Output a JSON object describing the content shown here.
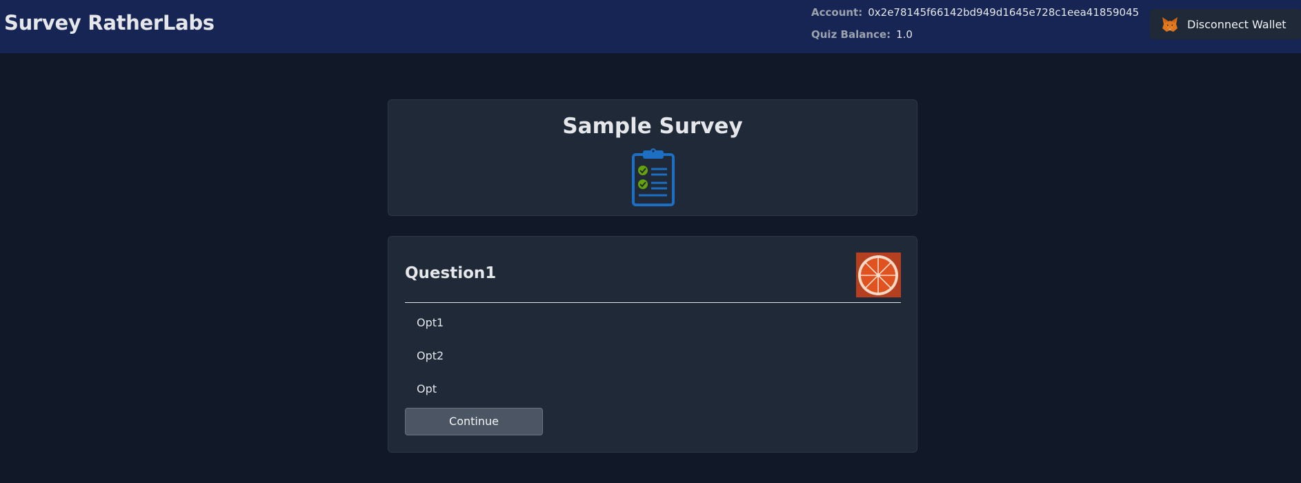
{
  "header": {
    "brand": "Survey RatherLabs",
    "account_label": "Account:",
    "account_value": "0x2e78145f66142bd949d1645e728c1eea41859045",
    "balance_label": "Quiz Balance:",
    "balance_value": "1.0",
    "wallet_button_label": "Disconnect Wallet",
    "wallet_icon": "metamask-fox-icon"
  },
  "survey": {
    "title": "Sample Survey",
    "icon": "clipboard-checklist-icon"
  },
  "question": {
    "title": "Question1",
    "image": "orange-slice-image",
    "options": [
      "Opt1",
      "Opt2",
      "Opt"
    ],
    "continue_label": "Continue"
  },
  "colors": {
    "header_bg": "#172554",
    "page_bg": "#111827",
    "card_bg": "#1f2937",
    "button_bg": "#4b5563",
    "clipboard_blue": "#1d6fc4",
    "check_green": "#65a30d"
  }
}
